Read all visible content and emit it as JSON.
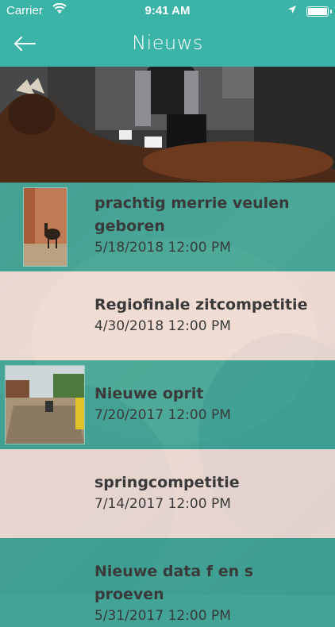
{
  "status_bar": {
    "carrier": "Carrier",
    "time": "9:41 AM"
  },
  "nav": {
    "title": "Nieuws",
    "back_icon": "arrow-left-icon"
  },
  "colors": {
    "accent": "#3bb3a7",
    "row_light": "#faece8",
    "text": "#3a3a3a"
  },
  "news": [
    {
      "title": "prachtig merrie veulen geboren",
      "date": "5/18/2018 12:00 PM",
      "has_thumb": true
    },
    {
      "title": "Regiofinale zitcompetitie",
      "date": "4/30/2018 12:00 PM",
      "has_thumb": false
    },
    {
      "title": "Nieuwe oprit",
      "date": "7/20/2017 12:00 PM",
      "has_thumb": true
    },
    {
      "title": "springcompetitie",
      "date": "7/14/2017 12:00 PM",
      "has_thumb": false
    },
    {
      "title": "Nieuwe data f en s proeven",
      "date": "5/31/2017 12:00 PM",
      "has_thumb": false
    }
  ]
}
